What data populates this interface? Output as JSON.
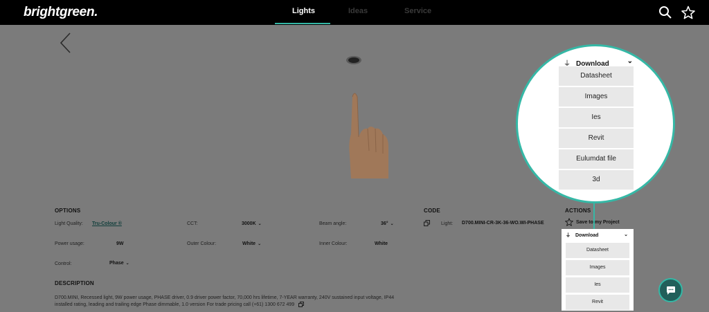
{
  "header": {
    "logo": "brightgreen.",
    "tabs": [
      {
        "label": "Lights",
        "active": true
      },
      {
        "label": "Ideas",
        "active": false
      },
      {
        "label": "Service",
        "active": false
      }
    ],
    "icons": [
      "search-icon",
      "star-icon"
    ]
  },
  "options": {
    "title": "OPTIONS",
    "light_quality_label": "Light Quality:",
    "light_quality_value": "Tru-Colour ®",
    "cct_label": "CCT:",
    "cct_value": "3000K",
    "beam_label": "Beam angle:",
    "beam_value": "36°",
    "power_label": "Power usage:",
    "power_value": "9W",
    "outer_label": "Outer Colour:",
    "outer_value": "White",
    "inner_label": "Inner Colour:",
    "inner_value": "White",
    "control_label": "Control:",
    "control_value": "Phase"
  },
  "description": {
    "title": "DESCRIPTION",
    "text": "D700.MINI, Recessed light, 9W power usage, PHASE driver, 0.9 driver power factor, 70,000 hrs lifetime, 7-YEAR warranty, 240V sustained input voltage, IP44 installed rating, leading and trailing edge Phase dimmable, 1.0 version For trade pricing call (+61) 1300 672 499"
  },
  "code": {
    "title": "CODE",
    "label": "Light:",
    "value": "D700.MINI-CR-3K-36-WO.WI-PHASE"
  },
  "actions": {
    "title": "ACTIONS",
    "save_label": "Save to my Project",
    "download_label": "Download",
    "download_items_visible": [
      "Datasheet",
      "Images",
      "Ies",
      "Revit"
    ]
  },
  "zoom": {
    "download_label": "Download",
    "items": [
      "Datasheet",
      "Images",
      "Ies",
      "Revit",
      "Eulumdat file",
      "3d"
    ]
  },
  "colors": {
    "accent": "#35b8a6",
    "header_bg": "#000000",
    "overlay_bg": "#7b7b7b"
  }
}
